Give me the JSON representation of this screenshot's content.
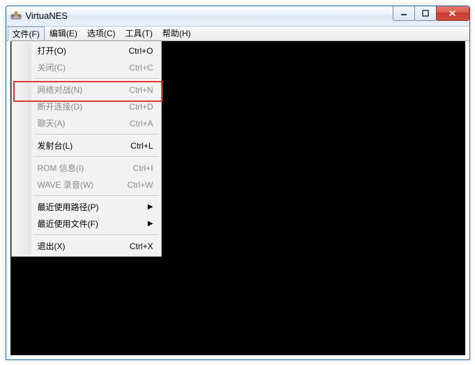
{
  "window": {
    "title": "VirtuaNES"
  },
  "menubar": {
    "items": [
      {
        "label": "文件(F)",
        "open": true
      },
      {
        "label": "编辑(E)"
      },
      {
        "label": "选项(C)"
      },
      {
        "label": "工具(T)"
      },
      {
        "label": "帮助(H)"
      }
    ]
  },
  "dropdown": {
    "items": [
      {
        "label": "打开(O)",
        "shortcut": "Ctrl+O",
        "disabled": false
      },
      {
        "label": "关闭(C)",
        "shortcut": "Ctrl+C",
        "disabled": true
      },
      {
        "type": "sep"
      },
      {
        "label": "网络对战(N)",
        "shortcut": "Ctrl+N",
        "disabled": true,
        "highlight": true
      },
      {
        "label": "断开连接(D)",
        "shortcut": "Ctrl+D",
        "disabled": true
      },
      {
        "label": "聊天(A)",
        "shortcut": "Ctrl+A",
        "disabled": true
      },
      {
        "type": "sep"
      },
      {
        "label": "发射台(L)",
        "shortcut": "Ctrl+L",
        "disabled": false
      },
      {
        "type": "sep"
      },
      {
        "label": "ROM 信息(I)",
        "shortcut": "Ctrl+I",
        "disabled": true
      },
      {
        "label": "WAVE 录音(W)",
        "shortcut": "Ctrl+W",
        "disabled": true
      },
      {
        "type": "sep"
      },
      {
        "label": "最近使用路径(P)",
        "submenu": true,
        "disabled": false
      },
      {
        "label": "最近使用文件(F)",
        "submenu": true,
        "disabled": false
      },
      {
        "type": "sep"
      },
      {
        "label": "退出(X)",
        "shortcut": "Ctrl+X",
        "disabled": false
      }
    ]
  }
}
